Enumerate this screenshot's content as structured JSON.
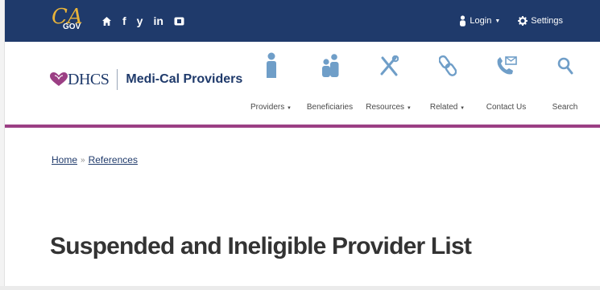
{
  "topbar": {
    "logo_main": "CA",
    "logo_sub": "GOV",
    "social_icons": [
      "home-icon",
      "facebook-icon",
      "twitter-icon",
      "linkedin-icon",
      "youtube-icon"
    ],
    "social_glyphs": {
      "facebook": "f",
      "twitter": "y",
      "linkedin": "in"
    },
    "login_label": "Login",
    "settings_label": "Settings"
  },
  "brand": {
    "dhcs": "DHCS",
    "name": "Medi-Cal Providers"
  },
  "nav": {
    "items": [
      {
        "label": "Providers",
        "dropdown": true,
        "icon": "person-icon"
      },
      {
        "label": "Beneficiaries",
        "dropdown": false,
        "icon": "people-icon"
      },
      {
        "label": "Resources",
        "dropdown": true,
        "icon": "tools-icon"
      },
      {
        "label": "Related",
        "dropdown": true,
        "icon": "link-icon"
      },
      {
        "label": "Contact Us",
        "dropdown": false,
        "icon": "phone-mail-icon"
      },
      {
        "label": "Search",
        "dropdown": false,
        "icon": "search-icon"
      }
    ]
  },
  "breadcrumb": {
    "home": "Home",
    "current": "References"
  },
  "page": {
    "title": "Suspended and Ineligible Provider List"
  },
  "colors": {
    "topbar": "#1f3a6b",
    "accent": "#9b3f84",
    "icon": "#6f9ec8",
    "logo_gold": "#e8b33a"
  }
}
